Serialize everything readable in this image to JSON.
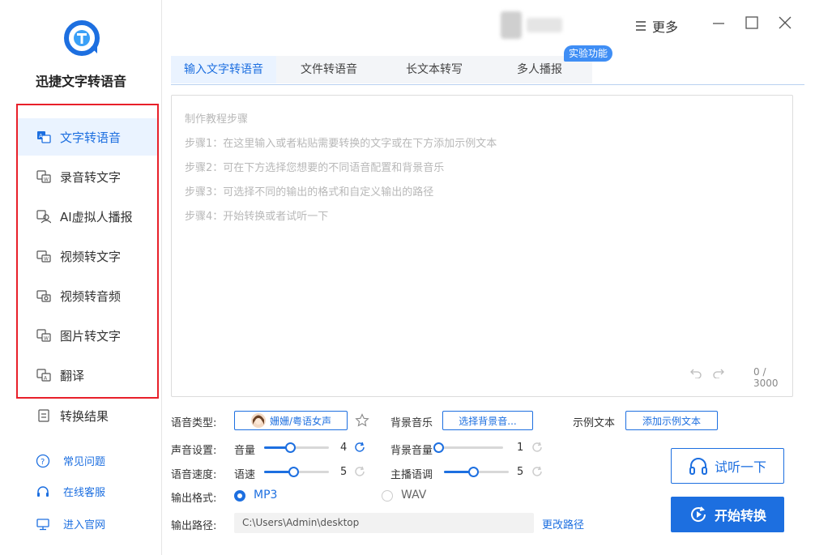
{
  "app": {
    "title": "迅捷文字转语音"
  },
  "sidebar": {
    "items": [
      {
        "label": "文字转语音",
        "icon": "text-to-speech-icon"
      },
      {
        "label": "录音转文字",
        "icon": "audio-to-text-icon"
      },
      {
        "label": "AI虚拟人播报",
        "icon": "virtual-human-icon"
      },
      {
        "label": "视频转文字",
        "icon": "video-to-text-icon"
      },
      {
        "label": "视频转音频",
        "icon": "video-to-audio-icon"
      },
      {
        "label": "图片转文字",
        "icon": "image-to-text-icon"
      },
      {
        "label": "翻译",
        "icon": "translate-icon"
      },
      {
        "label": "转换结果",
        "icon": "results-icon"
      }
    ],
    "links": [
      {
        "label": "常见问题",
        "icon": "question-icon"
      },
      {
        "label": "在线客服",
        "icon": "headset-icon"
      },
      {
        "label": "进入官网",
        "icon": "monitor-icon"
      }
    ]
  },
  "topbar": {
    "more_label": "更多"
  },
  "tabs": [
    {
      "label": "输入文字转语音"
    },
    {
      "label": "文件转语音"
    },
    {
      "label": "长文本转写"
    },
    {
      "label": "多人播报"
    }
  ],
  "badge": "实验功能",
  "editor": {
    "lines": [
      "制作教程步骤",
      "步骤1：在这里输入或者粘贴需要转换的文字或在下方添加示例文本",
      "步骤2：可在下方选择您想要的不同语音配置和背景音乐",
      "步骤3：可选择不同的输出的格式和自定义输出的路径",
      "步骤4：开始转换或者试听一下"
    ],
    "counter": "0 / 3000"
  },
  "settings": {
    "voice_type_label": "语音类型:",
    "voice_name": "姗姗/粤语女声",
    "bgm_label": "背景音乐",
    "bgm_button": "选择背景音...",
    "sample_label": "示例文本",
    "sample_button": "添加示例文本",
    "sound_label": "声音设置:",
    "volume_label": "音量",
    "volume_value": "4",
    "volume_fraction": 0.4,
    "bg_volume_label": "背景音量",
    "bg_volume_value": "1",
    "bg_volume_fraction": 0.0,
    "speed_section_label": "语音速度:",
    "speed_label": "语速",
    "speed_value": "5",
    "speed_fraction": 0.45,
    "pitch_label": "主播语调",
    "pitch_value": "5",
    "pitch_fraction": 0.45,
    "format_label": "输出格式:",
    "format_mp3": "MP3",
    "format_wav": "WAV",
    "format_selected": "MP3",
    "path_label": "输出路径:",
    "path_value": "C:\\Users\\Admin\\desktop",
    "change_path": "更改路径"
  },
  "actions": {
    "try_label": "试听一下",
    "start_label": "开始转换"
  },
  "colors": {
    "accent": "#1d6fe0",
    "highlight": "#e8202a",
    "active_bg": "#eaf3ff"
  }
}
